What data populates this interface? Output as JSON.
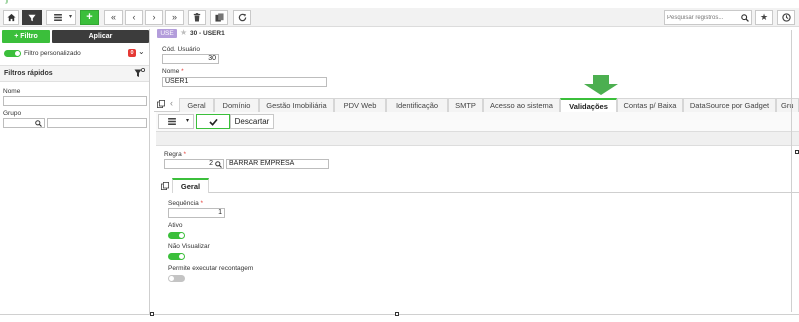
{
  "toolbar": {
    "home_icon": "home-icon",
    "filter_icon": "filter-icon",
    "add_label": "+",
    "first_icon": "«",
    "prev_icon": "‹",
    "next_icon": "›",
    "last_icon": "»",
    "search_placeholder": "Pesquisar registros...",
    "star_icon": "★"
  },
  "left_panel": {
    "filtro_label": "Filtro",
    "aplicar_label": "Aplicar",
    "filtro_personalizado": "Filtro personalizado",
    "badge_count": "0",
    "filtros_rapidos": "Filtros rápidos",
    "nome_label": "Nome",
    "grupo_label": "Grupo"
  },
  "header": {
    "badge": "USE",
    "title": "30 - USER1"
  },
  "form": {
    "cod_usuario_label": "Cód. Usuário",
    "cod_usuario_value": "30",
    "nome_label": "Nome",
    "nome_value": "USER1"
  },
  "tabs": [
    {
      "label": "Geral"
    },
    {
      "label": "Domínio"
    },
    {
      "label": "Gestão Imobiliária"
    },
    {
      "label": "PDV Web"
    },
    {
      "label": "Identificação"
    },
    {
      "label": "SMTP"
    },
    {
      "label": "Acesso ao sistema"
    },
    {
      "label": "Validações"
    },
    {
      "label": "Contas p/ Baixa"
    },
    {
      "label": "DataSource por Gadget"
    },
    {
      "label": "Gru"
    }
  ],
  "actions": {
    "descartar_label": "Descartar"
  },
  "validacao": {
    "regra_label": "Regra",
    "regra_code": "2",
    "regra_name": "BARRAR EMPRESA",
    "inner_tab": "Geral",
    "sequencia_label": "Sequência",
    "sequencia_value": "1",
    "ativo_label": "Ativo",
    "ativo_on": true,
    "nao_visualizar_label": "Não Visualizar",
    "nao_visualizar_on": true,
    "recontagem_label": "Permite executar recontagem",
    "recontagem_on": false
  },
  "colors": {
    "accent_green": "#3bbf3b",
    "dark": "#3c3c3c",
    "required_red": "#e53935",
    "use_badge": "#b39ddb"
  }
}
